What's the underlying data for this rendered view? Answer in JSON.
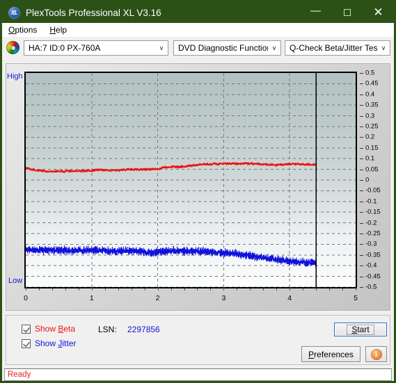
{
  "window": {
    "title": "PlexTools Professional XL V3.16",
    "icon": "xl-logo-icon",
    "minimize_label": "—",
    "maximize_label": "□",
    "close_label": "✕"
  },
  "menubar": {
    "items": [
      {
        "label_pre": "",
        "label_key": "O",
        "label_post": "ptions",
        "name": "menu-options"
      },
      {
        "label_pre": "",
        "label_key": "H",
        "label_post": "elp",
        "name": "menu-help"
      }
    ]
  },
  "toolbar": {
    "drive_icon": "disc-icon",
    "drive_select": "HA:7 ID:0  PX-760A",
    "function_select": "DVD Diagnostic Functions",
    "test_select": "Q-Check Beta/Jitter Test",
    "arrow": "∨"
  },
  "chart_data": {
    "type": "line",
    "title": "Q-Check Beta/Jitter Test",
    "xlabel": "",
    "ylabel": "",
    "xlim": [
      0,
      5
    ],
    "ylim": [
      -0.5,
      0.5
    ],
    "grid": true,
    "high_label": "High",
    "low_label": "Low",
    "x_ticks": [
      0,
      1,
      2,
      3,
      4,
      5
    ],
    "x_tick_labels": [
      "0",
      "1",
      "2",
      "3",
      "4",
      "5"
    ],
    "y_ticks": [
      0.5,
      0.45,
      0.4,
      0.35,
      0.3,
      0.25,
      0.2,
      0.15,
      0.1,
      0.05,
      0,
      -0.05,
      -0.1,
      -0.15,
      -0.2,
      -0.25,
      -0.3,
      -0.35,
      -0.4,
      -0.45,
      -0.5
    ],
    "y_tick_labels": [
      "0.5",
      "0.45",
      "0.4",
      "0.35",
      "0.3",
      "0.25",
      "0.2",
      "0.15",
      "0.1",
      "0.05",
      "0",
      "-0.05",
      "-0.1",
      "-0.15",
      "-0.2",
      "-0.25",
      "-0.3",
      "-0.35",
      "-0.4",
      "-0.45",
      "-0.5"
    ],
    "data_end_x": 4.4,
    "colors": {
      "beta": "#ee1111",
      "jitter": "#1111dd",
      "grid": "#777777",
      "axis": "#000000"
    },
    "series": [
      {
        "name": "Beta",
        "color": "#ee1111",
        "x": [
          0.0,
          0.1,
          0.2,
          0.3,
          0.4,
          0.5,
          0.6,
          0.7,
          0.8,
          0.9,
          1.0,
          1.1,
          1.2,
          1.3,
          1.4,
          1.5,
          1.6,
          1.7,
          1.8,
          1.9,
          2.0,
          2.1,
          2.2,
          2.3,
          2.4,
          2.5,
          2.6,
          2.7,
          2.8,
          2.9,
          3.0,
          3.1,
          3.2,
          3.3,
          3.4,
          3.5,
          3.6,
          3.7,
          3.8,
          3.9,
          4.0,
          4.1,
          4.2,
          4.3,
          4.4
        ],
        "values": [
          0.055,
          0.05,
          0.044,
          0.041,
          0.04,
          0.042,
          0.04,
          0.043,
          0.041,
          0.043,
          0.044,
          0.048,
          0.047,
          0.045,
          0.044,
          0.048,
          0.05,
          0.049,
          0.05,
          0.05,
          0.05,
          0.06,
          0.062,
          0.061,
          0.064,
          0.066,
          0.071,
          0.073,
          0.075,
          0.075,
          0.076,
          0.076,
          0.076,
          0.077,
          0.077,
          0.076,
          0.074,
          0.072,
          0.07,
          0.072,
          0.074,
          0.075,
          0.074,
          0.073,
          0.073
        ],
        "noise": 0.004
      },
      {
        "name": "Jitter",
        "color": "#1111dd",
        "x": [
          0.0,
          0.1,
          0.2,
          0.3,
          0.4,
          0.5,
          0.6,
          0.7,
          0.8,
          0.9,
          1.0,
          1.1,
          1.2,
          1.3,
          1.4,
          1.5,
          1.6,
          1.7,
          1.8,
          1.9,
          2.0,
          2.1,
          2.2,
          2.3,
          2.4,
          2.5,
          2.6,
          2.7,
          2.8,
          2.9,
          3.0,
          3.1,
          3.2,
          3.3,
          3.4,
          3.5,
          3.6,
          3.7,
          3.8,
          3.9,
          4.0,
          4.1,
          4.2,
          4.3,
          4.4
        ],
        "values": [
          -0.325,
          -0.325,
          -0.327,
          -0.328,
          -0.327,
          -0.326,
          -0.328,
          -0.33,
          -0.329,
          -0.328,
          -0.327,
          -0.329,
          -0.33,
          -0.332,
          -0.331,
          -0.33,
          -0.331,
          -0.333,
          -0.336,
          -0.34,
          -0.336,
          -0.332,
          -0.331,
          -0.33,
          -0.331,
          -0.332,
          -0.333,
          -0.334,
          -0.336,
          -0.338,
          -0.34,
          -0.342,
          -0.345,
          -0.349,
          -0.354,
          -0.358,
          -0.362,
          -0.367,
          -0.371,
          -0.375,
          -0.378,
          -0.381,
          -0.384,
          -0.386,
          -0.387
        ],
        "noise": 0.018
      }
    ]
  },
  "controls": {
    "show_beta": {
      "label_pre": "Show ",
      "label_key": "B",
      "label_post": "eta",
      "checked": true,
      "color": "#ee1111"
    },
    "show_jitter": {
      "label_pre": "Show ",
      "label_key": "J",
      "label_post": "itter",
      "checked": true,
      "color": "#1111dd"
    },
    "lsn_label": "LSN:",
    "lsn_value": "2297856",
    "start_label_pre": "",
    "start_key": "S",
    "start_label_post": "tart",
    "prefs_label_pre": "",
    "prefs_key": "P",
    "prefs_label_post": "references",
    "info_icon": "info-icon",
    "info_glyph": "i"
  },
  "statusbar": {
    "text": "Ready"
  }
}
